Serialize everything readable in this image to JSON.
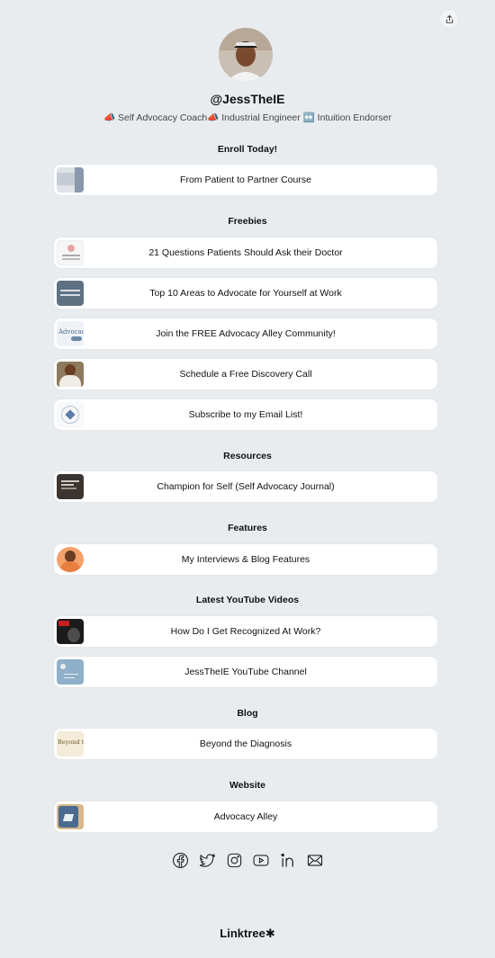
{
  "profile": {
    "handle": "@JessTheIE",
    "bio": "📣 Self Advocacy Coach📣 Industrial Engineer ↔️ Intuition Endorser"
  },
  "sections": {
    "enroll": "Enroll Today!",
    "freebies": "Freebies",
    "resources": "Resources",
    "features": "Features",
    "youtube": "Latest YouTube Videos",
    "blog": "Blog",
    "website": "Website"
  },
  "links": {
    "course": "From Patient to Partner Course",
    "questions": "21 Questions Patients Should Ask their Doctor",
    "top10": "Top 10 Areas to Advocate for Yourself at Work",
    "community": "Join the FREE Advocacy Alley Community!",
    "discovery": "Schedule a Free Discovery Call",
    "email": "Subscribe to my Email List!",
    "journal": "Champion for Self (Self Advocacy Journal)",
    "interviews": "My Interviews & Blog Features",
    "recognized": "How Do I Get Recognized At Work?",
    "channel": "JessTheIE YouTube Channel",
    "diagnosis": "Beyond the Diagnosis",
    "alley": "Advocacy Alley"
  },
  "thumb_text": {
    "community": "Advocacy",
    "diagnosis": "Beyond the"
  },
  "socials": [
    "facebook-icon",
    "twitter-icon",
    "instagram-icon",
    "youtube-icon",
    "linkedin-icon",
    "email-icon"
  ],
  "footer": {
    "brand": "Linktree✱"
  },
  "colors": {
    "background": "#e9ecef",
    "card": "#ffffff",
    "text": "#111111"
  }
}
